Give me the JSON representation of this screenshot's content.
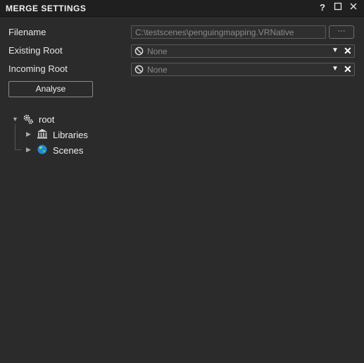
{
  "window": {
    "title": "MERGE SETTINGS",
    "controls": {
      "help": "?",
      "maximize": "☐",
      "close": "✕"
    }
  },
  "form": {
    "filename": {
      "label": "Filename",
      "value": "C:\\testscenes\\penguingmapping.VRNative",
      "browse": "···"
    },
    "existing_root": {
      "label": "Existing Root",
      "value": "None"
    },
    "incoming_root": {
      "label": "Incoming Root",
      "value": "None"
    },
    "analyse_button": "Analyse"
  },
  "tree": {
    "root": {
      "label": "root",
      "icon": "gears-icon"
    },
    "children": [
      {
        "label": "Libraries",
        "icon": "library-icon"
      },
      {
        "label": "Scenes",
        "icon": "globe-icon"
      }
    ]
  }
}
